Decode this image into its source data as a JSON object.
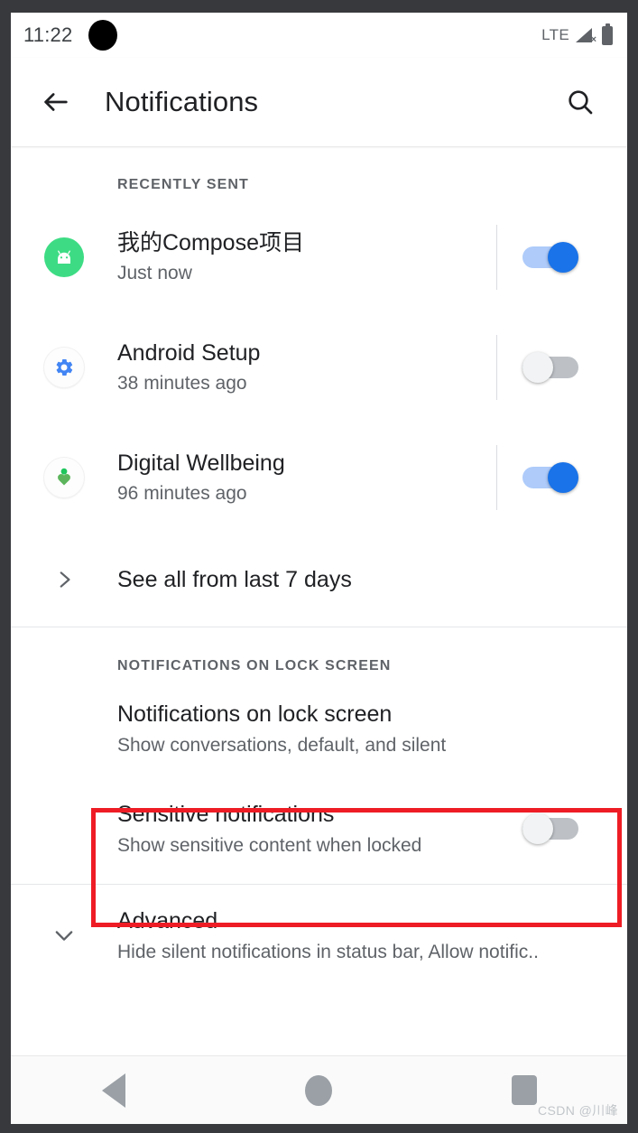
{
  "status_bar": {
    "time": "11:22",
    "network_label": "LTE",
    "signal_icon": "signal-no-service-icon",
    "battery_icon": "battery-full-icon",
    "camera_cutout": "camera-cutout"
  },
  "app_bar": {
    "back_icon": "arrow-back-icon",
    "title": "Notifications",
    "search_icon": "search-icon"
  },
  "sections": {
    "recently_sent": {
      "header": "RECENTLY SENT",
      "apps": [
        {
          "name": "我的Compose项目",
          "time": "Just now",
          "icon": "android-robot-icon",
          "toggle": "on"
        },
        {
          "name": "Android Setup",
          "time": "38 minutes ago",
          "icon": "gear-icon",
          "toggle": "off"
        },
        {
          "name": "Digital Wellbeing",
          "time": "96 minutes ago",
          "icon": "digital-wellbeing-icon",
          "toggle": "on"
        }
      ],
      "see_all": {
        "label": "See all from last 7 days",
        "icon": "chevron-right-icon"
      }
    },
    "lock_screen": {
      "header": "NOTIFICATIONS ON LOCK SCREEN",
      "items": [
        {
          "title": "Notifications on lock screen",
          "subtitle": "Show conversations, default, and silent",
          "has_toggle": false
        },
        {
          "title": "Sensitive notifications",
          "subtitle": "Show sensitive content when locked",
          "has_toggle": true,
          "toggle": "off",
          "highlighted": true
        }
      ]
    },
    "advanced": {
      "title": "Advanced",
      "subtitle": "Hide silent notifications in status bar, Allow notific..",
      "icon": "chevron-down-icon"
    }
  },
  "nav_bar": {
    "back": "back-triangle-icon",
    "home": "home-circle-icon",
    "recents": "recents-square-icon"
  },
  "watermark": "CSDN @川峰",
  "colors": {
    "accent_blue": "#1a73e8",
    "track_blue": "#aecbfa",
    "android_green": "#3ddc84",
    "highlight_red": "#ee1c25",
    "text_primary": "#202124",
    "text_secondary": "#5f6368"
  }
}
